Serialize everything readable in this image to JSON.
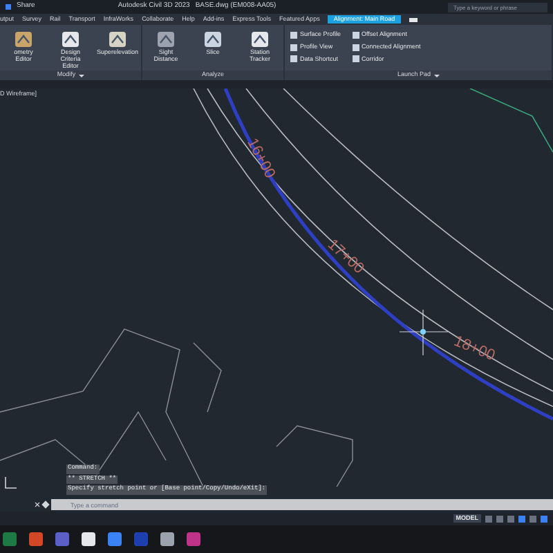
{
  "title_bar": {
    "share": "Share",
    "app": "Autodesk Civil 3D 2023",
    "file": "BASE.dwg (EM008-AA05)",
    "search_placeholder": "Type a keyword or phrase"
  },
  "ribbon_tabs": [
    {
      "label": "utput",
      "selected": false
    },
    {
      "label": "Survey",
      "selected": false
    },
    {
      "label": "Rail",
      "selected": false
    },
    {
      "label": "Transport",
      "selected": false
    },
    {
      "label": "InfraWorks",
      "selected": false
    },
    {
      "label": "Collaborate",
      "selected": false
    },
    {
      "label": "Help",
      "selected": false
    },
    {
      "label": "Add-ins",
      "selected": false
    },
    {
      "label": "Express Tools",
      "selected": false
    },
    {
      "label": "Featured Apps",
      "selected": false
    },
    {
      "label": "Alignment: Main Road",
      "selected": true
    }
  ],
  "ribbon_panels": [
    {
      "label": "Modify",
      "has_menu": true,
      "buttons": [
        {
          "label": "ometry Editor",
          "kind": "large"
        },
        {
          "label": "Design Criteria Editor",
          "kind": "large"
        },
        {
          "label": "Superelevation",
          "kind": "large"
        }
      ]
    },
    {
      "label": "Analyze",
      "has_menu": false,
      "buttons": [
        {
          "label": "Sight Distance",
          "kind": "large"
        },
        {
          "label": "Slice",
          "kind": "large"
        },
        {
          "label": "Station Tracker",
          "kind": "large"
        }
      ]
    },
    {
      "label": "Launch Pad",
      "has_menu": true,
      "buttons": [
        {
          "label": "Surface Profile",
          "kind": "small"
        },
        {
          "label": "Profile View",
          "kind": "small"
        },
        {
          "label": "Data Shortcut",
          "kind": "small"
        },
        {
          "label": "Offset Alignment",
          "kind": "small"
        },
        {
          "label": "Connected Alignment",
          "kind": "small"
        },
        {
          "label": "Corridor",
          "kind": "small"
        }
      ]
    }
  ],
  "viewport": {
    "label": "D Wireframe]",
    "stations": [
      "16+00",
      "17+00",
      "18+00"
    ]
  },
  "command_history": [
    "Command:",
    "** STRETCH **",
    "Specify stretch point or [Base point/Copy/Undo/eXit]:"
  ],
  "command_input": {
    "placeholder": "Type a command"
  },
  "status_bar": {
    "mode": "MODEL"
  }
}
